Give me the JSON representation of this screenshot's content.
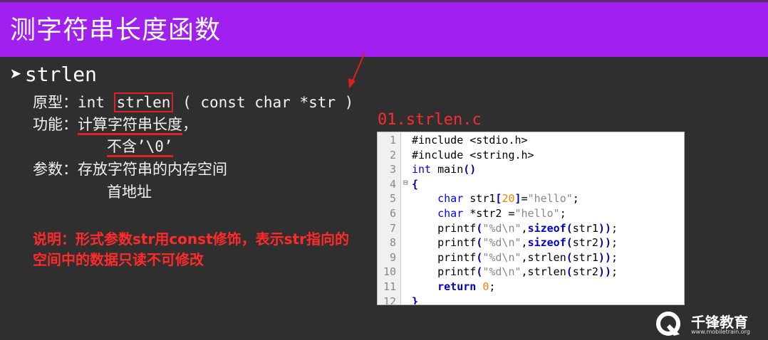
{
  "slide": {
    "title": "测字符串长度函数",
    "heading": "strlen",
    "prototype": {
      "label": "原型：",
      "pre": "int ",
      "func": "strlen",
      "post": " ( const char *str )"
    },
    "function": {
      "label": "功能：",
      "line1": "计算字符串长度",
      "line1_tail": "，",
      "line2": "不含’\\0’"
    },
    "params": {
      "label": "参数：",
      "line1": "存放字符串的内存空间",
      "line2": "首地址"
    },
    "note": "说明：形式参数str用const修饰，表示str指向的空间中的数据只读不可修改",
    "file_label": "01.strlen.c"
  },
  "code_lines": [
    {
      "n": "1",
      "text": "#include <stdio.h>"
    },
    {
      "n": "2",
      "text": "#include <string.h>"
    },
    {
      "n": "3",
      "text": "int main()"
    },
    {
      "n": "4",
      "text": "{"
    },
    {
      "n": "5",
      "text": "    char str1[20]=\"hello\";"
    },
    {
      "n": "6",
      "text": "    char *str2 =\"hello\";"
    },
    {
      "n": "7",
      "text": "    printf(\"%d\\n\",sizeof(str1));"
    },
    {
      "n": "8",
      "text": "    printf(\"%d\\n\",sizeof(str2));"
    },
    {
      "n": "9",
      "text": "    printf(\"%d\\n\",strlen(str1));"
    },
    {
      "n": "10",
      "text": "    printf(\"%d\\n\",strlen(str2));"
    },
    {
      "n": "11",
      "text": "    return 0;"
    },
    {
      "n": "12",
      "text": "}"
    }
  ],
  "logo": {
    "name": "千锋教育",
    "url": "www.mobiletrain.org"
  },
  "colors": {
    "title_bar": "#a020f0",
    "background": "#2f2f2f",
    "accent_red": "#e02020"
  }
}
